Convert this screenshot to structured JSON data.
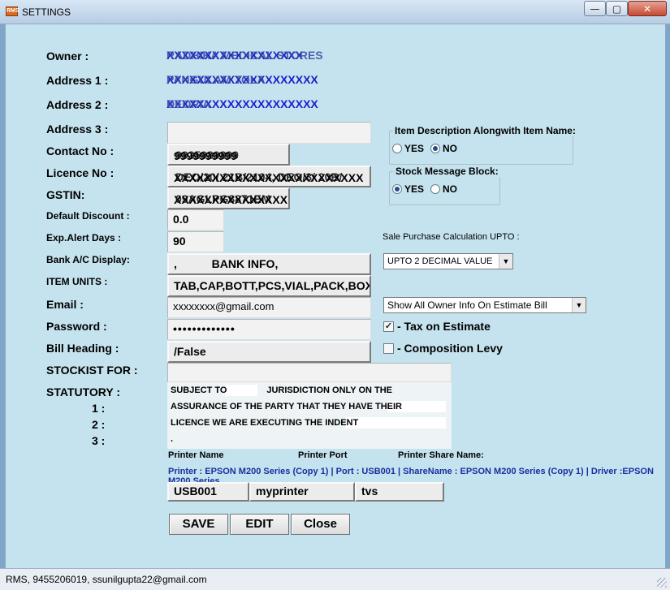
{
  "window": {
    "icon_text": "RMS",
    "title": "SETTINGS",
    "controls": {
      "minimize": "—",
      "maximize": "▢",
      "close": "✕"
    }
  },
  "form": {
    "labels": {
      "owner": "Owner :",
      "address1": "Address 1 :",
      "address2": "Address 2 :",
      "address3": "Address 3 :",
      "contact": "Contact No :",
      "licence": "Licence No :",
      "gstin": "GSTIN:",
      "default_discount": "Default Discount :",
      "exp_alert_days": "Exp.Alert Days :",
      "bank_ac_display": "Bank A/C Display:",
      "item_units": "ITEM UNITS :",
      "email": "Email :",
      "password": "Password :",
      "bill_heading": "Bill Heading :",
      "stockist_for": "STOCKIST FOR :",
      "statutory": "STATUTORY :",
      "stat1": "1 :",
      "stat2": "2 :",
      "stat3": "3 :"
    },
    "values": {
      "owner_a": "XXXXXXXXXXXXXXXXXX",
      "owner_b": "RADHIKA MEDICAL STORES",
      "address1_a": "XXXXXXXXXXXXXXXXXXXX",
      "address1_b": "PANGULAM TOLA",
      "address2_a": "XXXXXXXXXXXXXXXXXXXX",
      "address2_b": "DEORIA",
      "address3": "",
      "contact_a": "9999999999",
      "contact_b": "9935989899",
      "licence_a": "XXXXXXXXXXXXXXXXXXXXXXXXX",
      "licence_b": "DEO/20/ 21B/2104, DEO/3/ 20B/",
      "gstin_a": "XXXXXXXXXXXXXXX",
      "gstin_b": "09AGLPG8871EM",
      "default_discount": "0.0",
      "exp_alert_days": "90",
      "bank_ac_display": ",           BANK INFO,",
      "item_units": "TAB,CAP,BOTT,PCS,VIAL,PACK,BOX",
      "email": "xxxxxxxx@gmail.com",
      "password": "•••••••••••••",
      "bill_heading": "/False",
      "stockist_for": ""
    },
    "statutory": {
      "line1": "SUBJECT TO                JURISDICTION ONLY ON THE",
      "line2": "ASSURANCE OF THE PARTY THAT THEY HAVE THEIR",
      "line3": "LICENCE WE ARE EXECUTING THE INDENT",
      "line4": "."
    }
  },
  "options": {
    "item_desc": {
      "title": "Item Description Alongwith Item Name:",
      "yes": "YES",
      "no": "NO",
      "selected": "NO"
    },
    "stock_msg": {
      "title": "Stock Message Block:",
      "yes": "YES",
      "no": "NO",
      "selected": "YES"
    },
    "sale_purchase_label": "Sale Purchase Calculation UPTO :",
    "decimal_select": "UPTO 2 DECIMAL VALUE",
    "estimate_select": "Show All Owner Info On Estimate Bill",
    "tax_on_estimate": {
      "label": "- Tax on Estimate",
      "checked": true,
      "mark": "✓"
    },
    "composition_levy": {
      "label": "- Composition Levy",
      "checked": false
    }
  },
  "printer": {
    "headers": {
      "name": "Printer Name",
      "port": "Printer Port",
      "share": "Printer Share Name:"
    },
    "info": "Printer : EPSON M200 Series (Copy 1) | Port : USB001  | ShareName : EPSON M200 Series (Copy 1) | Driver :EPSON M200 Series",
    "port_value": "USB001",
    "name_value": "myprinter",
    "share_value": "tvs"
  },
  "buttons": {
    "save": "SAVE",
    "edit": "EDIT",
    "close": "Close"
  },
  "status": {
    "text": "RMS, 9455206019, ssunilgupta22@gmail.com"
  },
  "colors": {
    "client_bg": "#c5e3ee",
    "overlap_text": "#1d1dcc",
    "printer_info": "#1a2ea0"
  }
}
